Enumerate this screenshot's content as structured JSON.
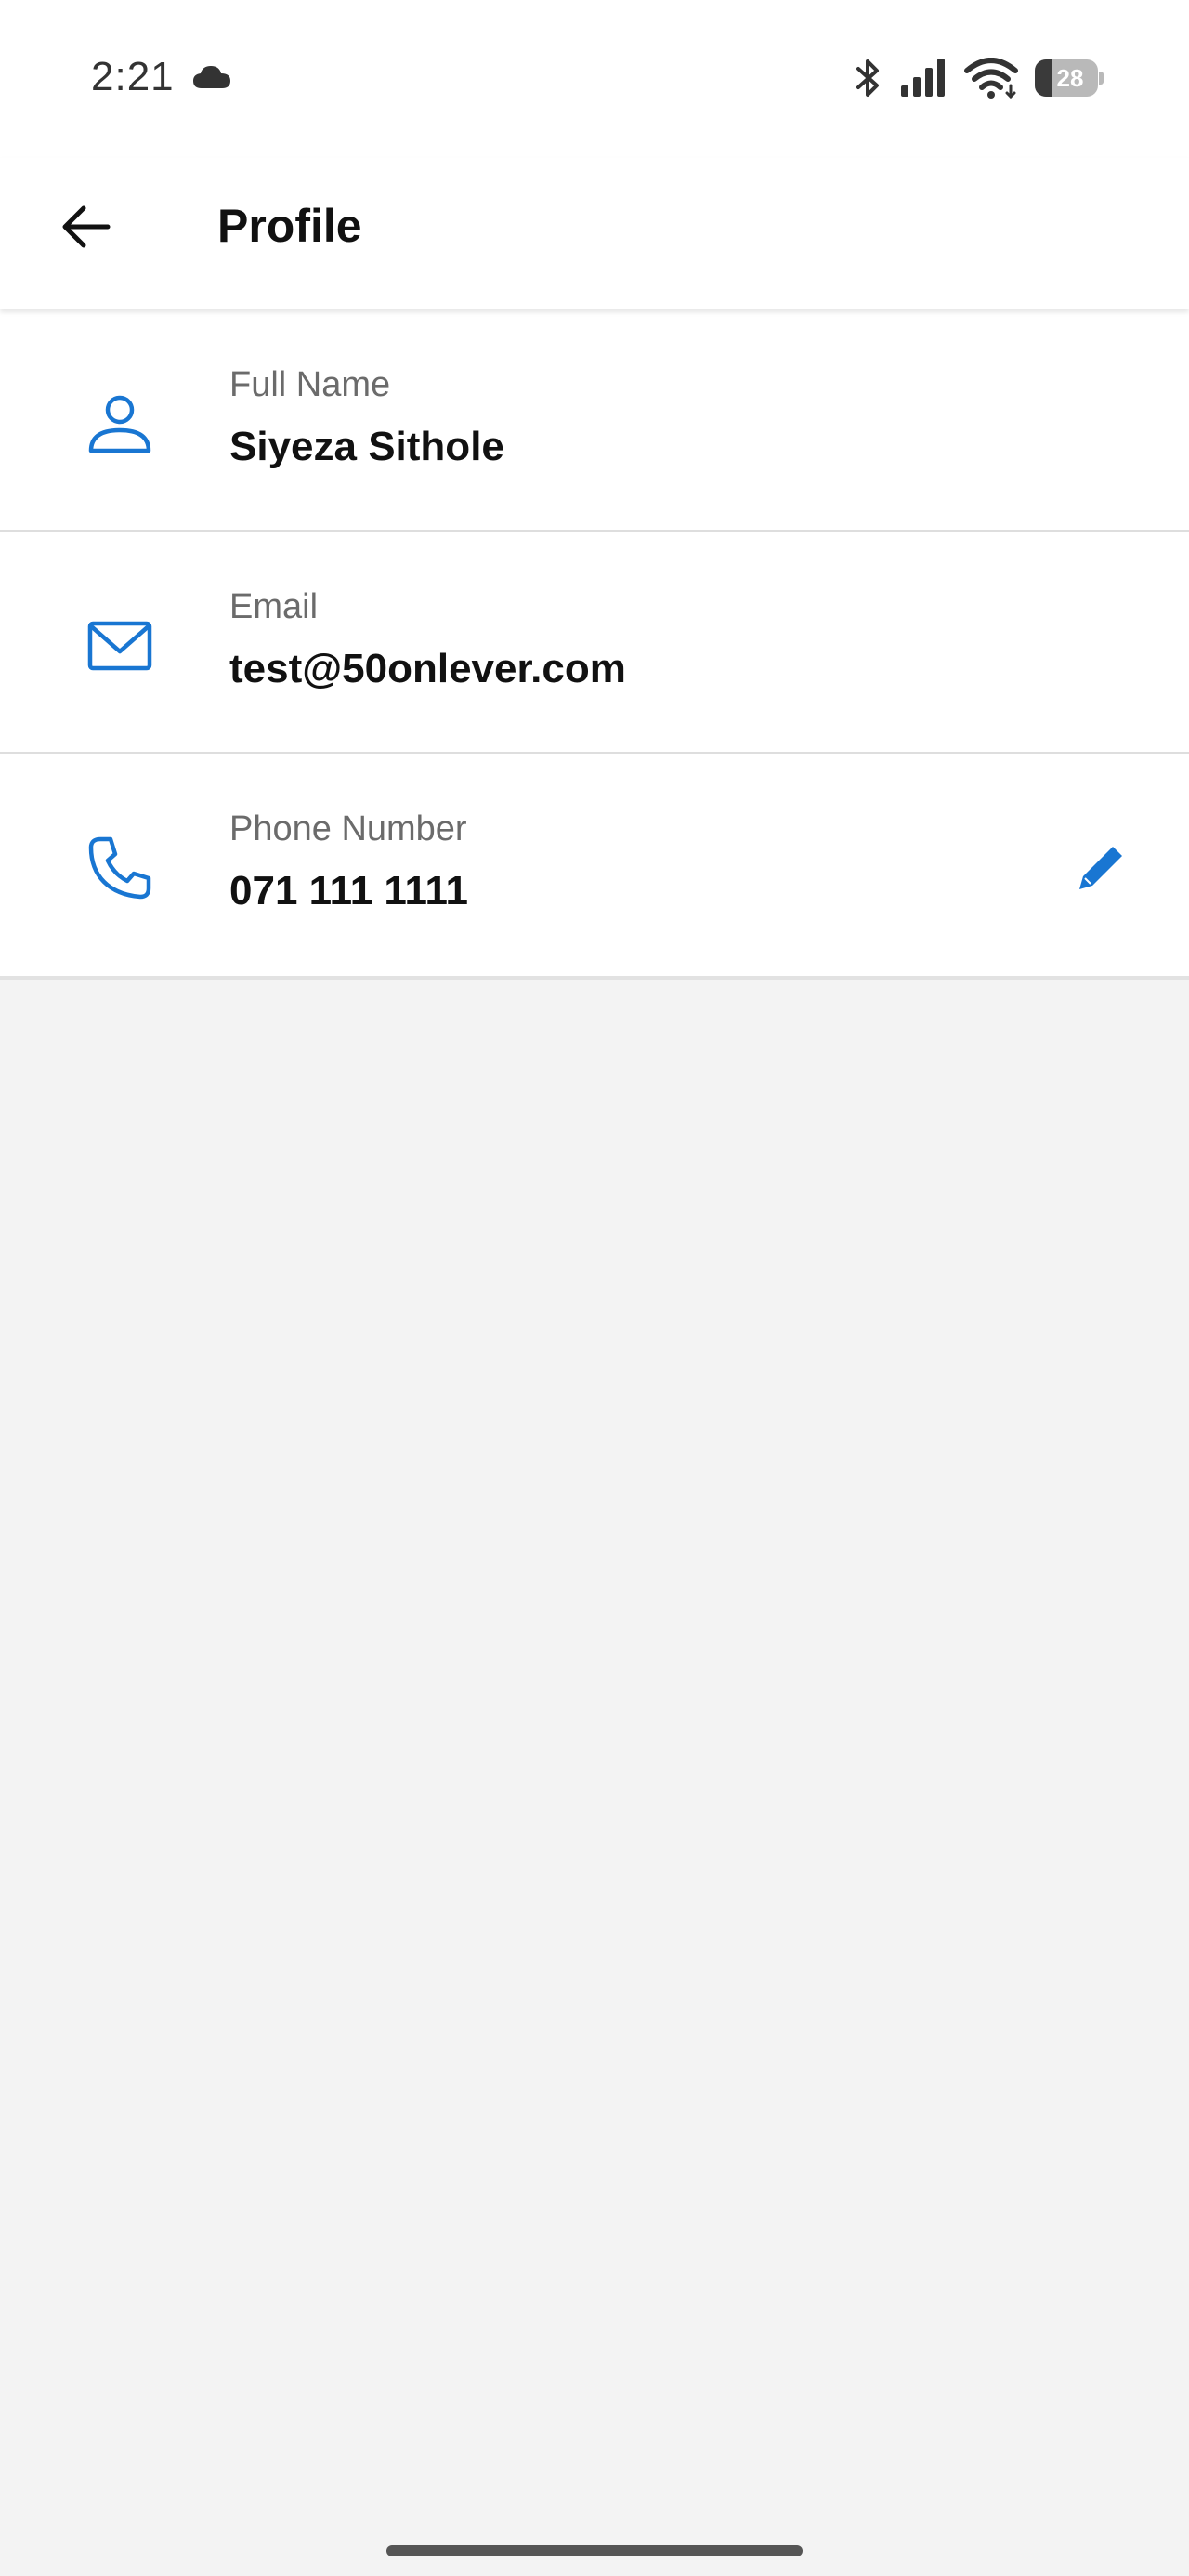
{
  "status_bar": {
    "time": "2:21",
    "battery_level": "28",
    "battery_fraction": 0.28,
    "icons": [
      "cloud-icon",
      "bluetooth-icon",
      "signal-icon",
      "wifi-icon",
      "battery-icon"
    ]
  },
  "app_bar": {
    "title": "Profile",
    "back_icon": "arrow-left-icon"
  },
  "profile": {
    "fields": [
      {
        "label": "Full Name",
        "value": "Siyeza Sithole",
        "icon": "person-icon"
      },
      {
        "label": "Email",
        "value": "test@50onlever.com",
        "icon": "mail-icon"
      },
      {
        "label": "Phone Number",
        "value": "071 111 1111",
        "icon": "phone-icon",
        "editable": true,
        "edit_icon": "pencil-icon"
      }
    ]
  },
  "colors": {
    "accent": "#1976d2",
    "background": "#f3f3f3",
    "surface": "#ffffff",
    "label_text": "#6b6b6b",
    "value_text": "#111111"
  }
}
